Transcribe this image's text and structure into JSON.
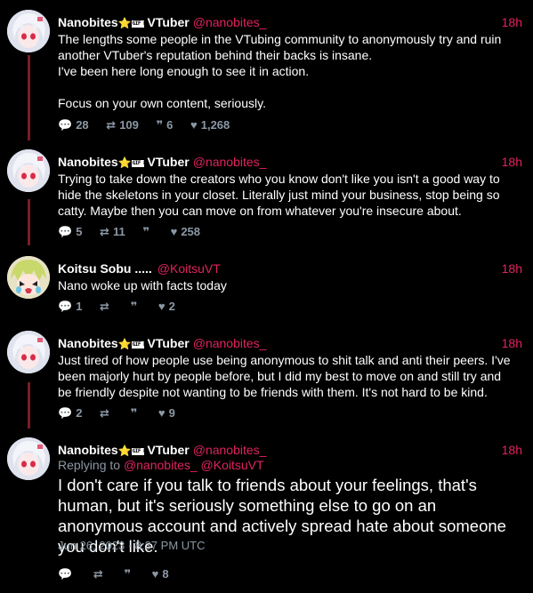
{
  "colors": {
    "background": "#000000",
    "accent": "#e0245e",
    "thread_line": "#7a1c22",
    "muted": "#8b98a5"
  },
  "icons": {
    "reply": "comment-bubble-icon",
    "retweet": "retweet-icon",
    "quote": "quote-icon",
    "like": "heart-icon"
  },
  "tweets": [
    {
      "name": "Nanobites",
      "emoji": "⭐",
      "badge": "GIF REI",
      "suffix": "VTuber",
      "handle": "@nanobites_",
      "time": "18h",
      "lines": [
        "The lengths some people in the VTubing community to anonymously try and ruin another VTuber's reputation behind their backs is insane.",
        "I've been here long enough to see it in action.",
        "",
        "Focus on your own content, seriously."
      ],
      "stats": {
        "replies": "28",
        "retweets": "109",
        "quotes": "6",
        "likes": "1,268"
      }
    },
    {
      "name": "Nanobites",
      "emoji": "⭐",
      "badge": "GIF REI",
      "suffix": "VTuber",
      "handle": "@nanobites_",
      "time": "18h",
      "lines": [
        "Trying to take down the creators who you know don't like you isn't a good way to hide the skeletons in your closet. Literally just mind your business, stop being so catty. Maybe then you can move on from whatever you're insecure about."
      ],
      "stats": {
        "replies": "5",
        "retweets": "11",
        "quotes": "",
        "likes": "258"
      }
    },
    {
      "name": "Koitsu Sobu .....",
      "handle": "@KoitsuVT",
      "time": "18h",
      "lines": [
        "Nano woke up with facts today"
      ],
      "stats": {
        "replies": "1",
        "retweets": "",
        "quotes": "",
        "likes": "2"
      }
    },
    {
      "name": "Nanobites",
      "emoji": "⭐",
      "badge": "GIF REI",
      "suffix": "VTuber",
      "handle": "@nanobites_",
      "time": "18h",
      "lines": [
        "Just tired of how people use being anonymous to shit talk and anti their peers. I've been majorly hurt by people before, but I did my best to move on and still try and be friendly despite not wanting to be friends with them. It's not hard to be kind."
      ],
      "stats": {
        "replies": "2",
        "retweets": "",
        "quotes": "",
        "likes": "9"
      }
    },
    {
      "name": "Nanobites",
      "emoji": "⭐",
      "badge": "GIF REI",
      "suffix": "VTuber",
      "handle": "@nanobites_",
      "time": "18h",
      "replying_label": "Replying to",
      "replying_to": "@nanobites_ @KoitsuVT",
      "text": "I don't care if you talk to friends about your feelings, that's human, but it's seriously something else to go on an anonymous account and actively spread hate about someone you don't like.",
      "date": "Jun 26, 2023 · 8:37 PM UTC",
      "stats": {
        "replies": "",
        "retweets": "",
        "quotes": "",
        "likes": "8"
      }
    }
  ]
}
